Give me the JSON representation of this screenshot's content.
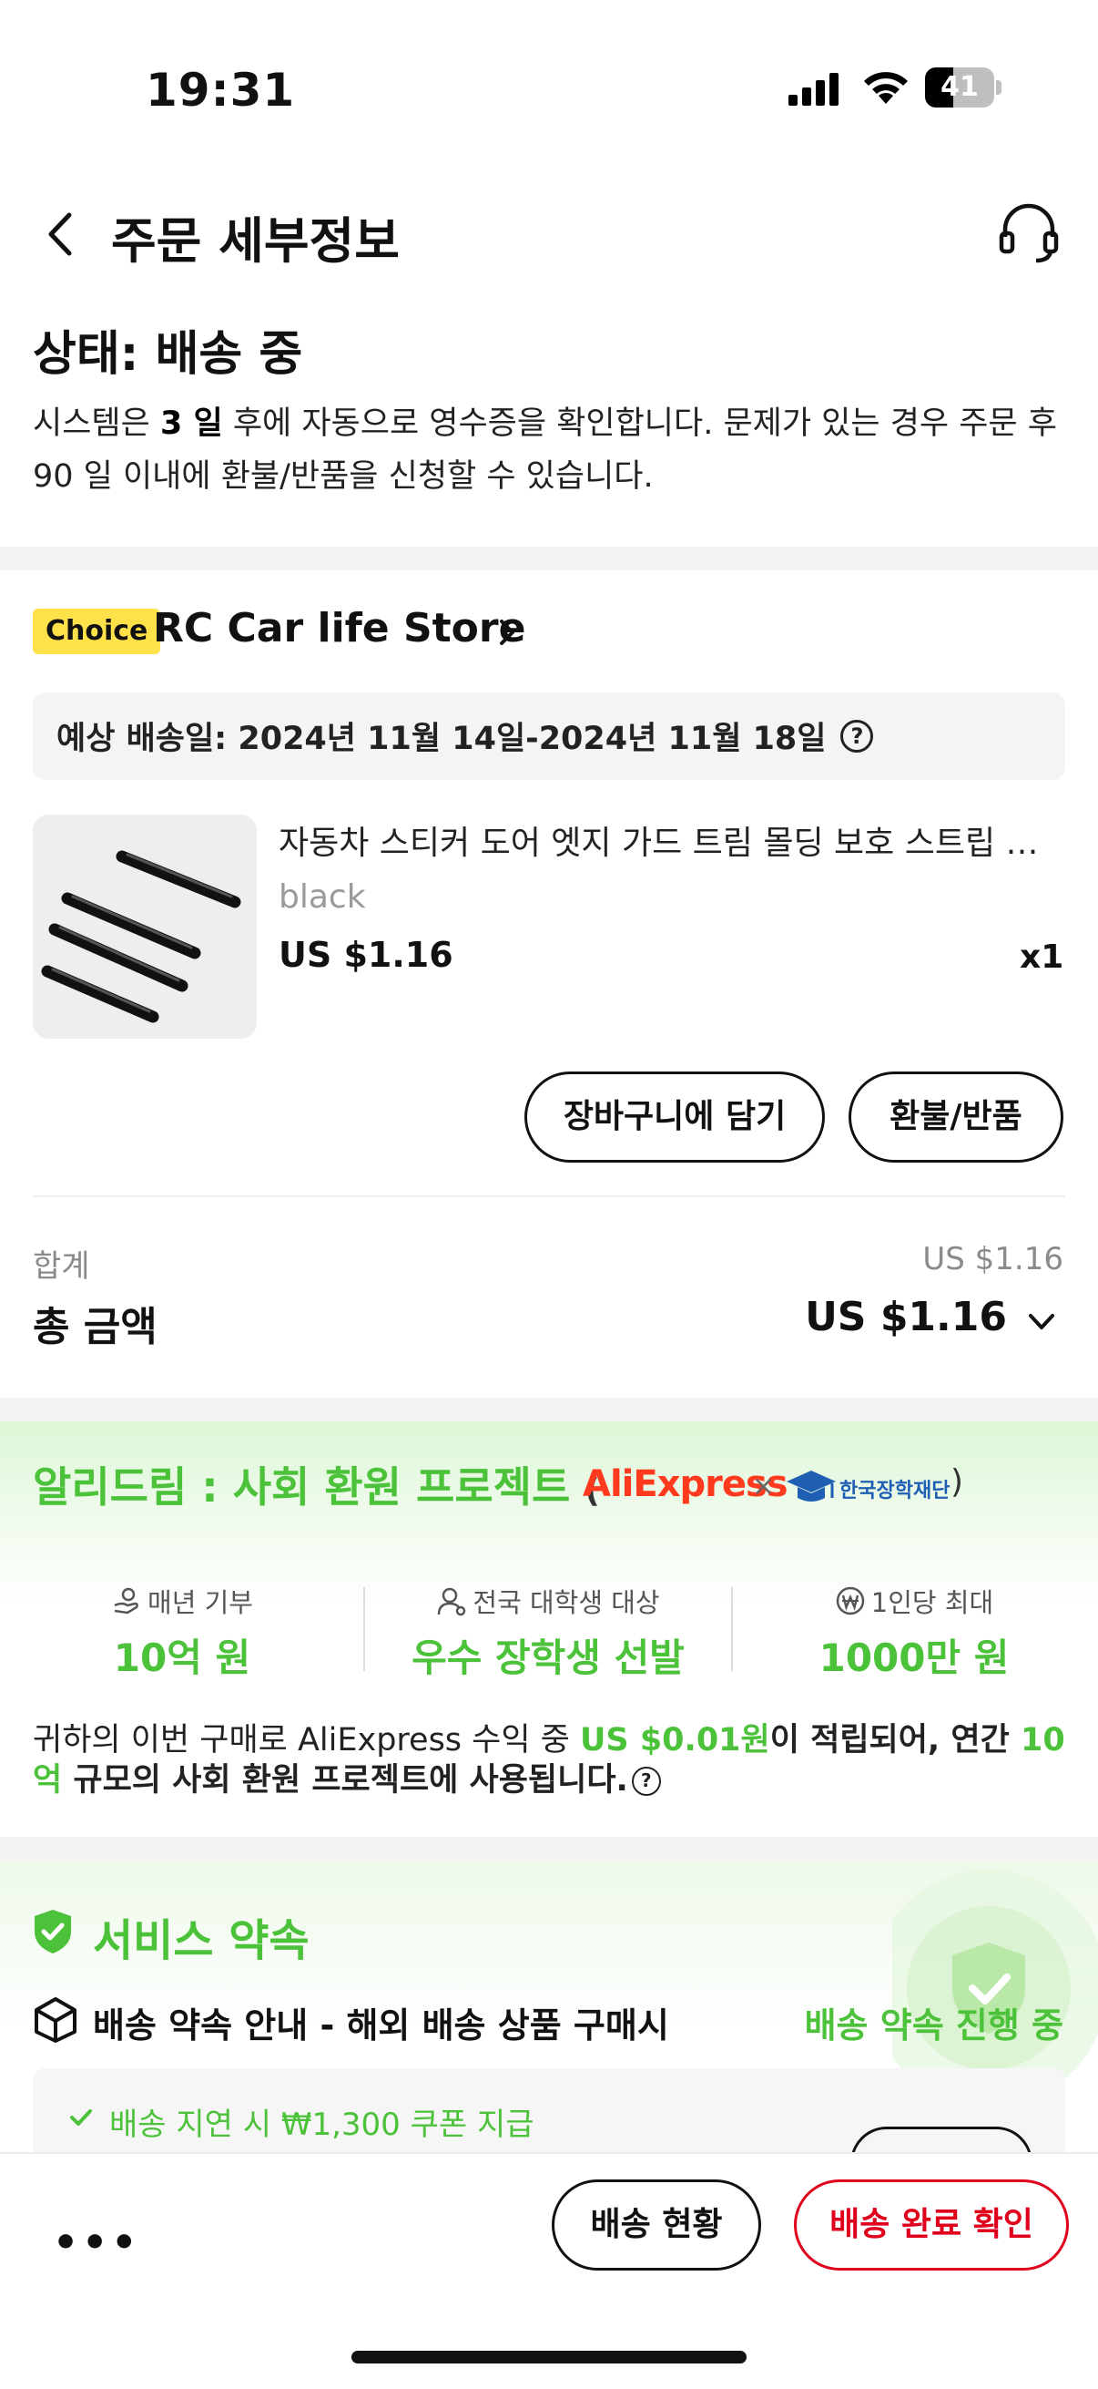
{
  "status_bar": {
    "time": "19:31",
    "battery": "41",
    "battery_level": 0.41
  },
  "header": {
    "title": "주문 세부정보"
  },
  "order_status": {
    "title": "상태: 배송 중",
    "desc_part1": "시스템은 ",
    "desc_days": "3 일",
    "desc_part2": " 후에 자동으로 영수증을 확인합니다. 문제가 있는 경우 주문 후 90 일 이내에 환불/반품을 신청할 수 있습니다."
  },
  "store": {
    "badge": "Choice",
    "name": "RC Car life Store",
    "delivery_estimate": "예상 배송일: 2024년 11월 14일-2024년 11월 18일",
    "help_glyph": "?"
  },
  "product": {
    "name": "자동차 스티커 도어 엣지 가드 트림 몰딩 보호 스트립 스크래치 방지",
    "variant": "black",
    "price": "US $1.16",
    "qty": "x1"
  },
  "actions": {
    "add_to_cart": "장바구니에 담기",
    "refund": "환불/반품"
  },
  "summary": {
    "subtotal_label": "합계",
    "subtotal_value": "US $1.16",
    "total_label": "총 금액",
    "total_value": "US $1.16"
  },
  "ali_dream": {
    "title": "알리드림 : 사회 환원 프로젝트",
    "paren_open": "(",
    "paren_close": ")",
    "partner_logo": "AliExpress",
    "times": "×",
    "foundation": "한국장학재단",
    "stats": [
      {
        "label": "매년 기부",
        "value": "10억 원",
        "icon": "donate-icon"
      },
      {
        "label": "전국 대학생 대상",
        "value": "우수 장학생 선발",
        "icon": "student-icon"
      },
      {
        "label": "1인당 최대",
        "value": "1000만 원",
        "icon": "won-icon"
      }
    ],
    "desc_part1": "귀하의 이번 구매로 AliExpress 수익 중 ",
    "desc_amount": "US $0.01원",
    "desc_part2": "이 적립되어, 연간 ",
    "desc_scale": "10억",
    "desc_part3": " 규모의 사회 환원 프로젝트에 사용됩니다.",
    "help_glyph": "?"
  },
  "service": {
    "title": "서비스 약속",
    "promise_title": "배송 약속 안내 - 해외 배송 상품 구매시",
    "promise_status": "배송 약속 진행 중",
    "promise_item": "배송 지연 시 ₩1,300 쿠폰 지급"
  },
  "bottom_bar": {
    "more": "•••",
    "track": "배송 현황",
    "confirm": "배송 완료 확인"
  },
  "colors": {
    "accent_green": "#4cc23a",
    "confirm_red": "#e0001b",
    "choice_yellow": "#ffe24a"
  }
}
